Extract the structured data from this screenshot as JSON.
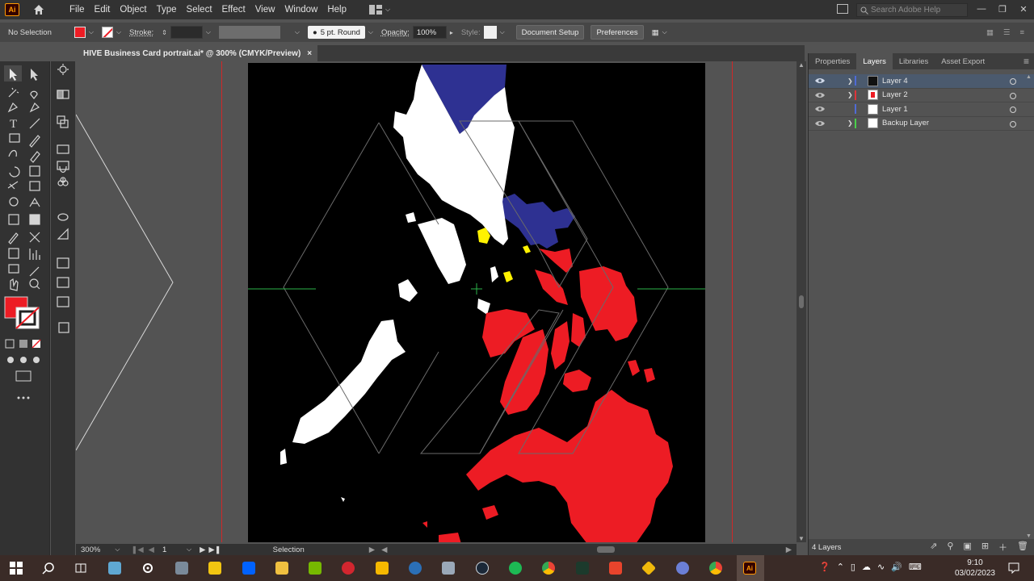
{
  "app": {
    "menu": [
      "File",
      "Edit",
      "Object",
      "Type",
      "Select",
      "Effect",
      "View",
      "Window",
      "Help"
    ],
    "search_placeholder": "Search Adobe Help",
    "logo_text": "Ai"
  },
  "control_bar": {
    "selection": "No Selection",
    "stroke_label": "Stroke:",
    "brush": "5 pt. Round",
    "opacity_label": "Opacity:",
    "opacity_value": "100%",
    "style_label": "Style:",
    "document_setup": "Document Setup",
    "preferences": "Preferences"
  },
  "document": {
    "tab_title": "HIVE Business Card portrait.ai* @ 300% (CMYK/Preview)",
    "close": "×"
  },
  "status": {
    "zoom": "300%",
    "artboard": "1",
    "tool": "Selection"
  },
  "panel": {
    "tabs": [
      "Properties",
      "Layers",
      "Libraries",
      "Asset Export"
    ],
    "active_tab": "Layers",
    "layers": [
      {
        "name": "Layer 4",
        "color": "#4f6bd6",
        "selected": true
      },
      {
        "name": "Layer 2",
        "color": "#e0343a",
        "selected": false
      },
      {
        "name": "Layer 1",
        "color": "#4f6bd6",
        "selected": false
      },
      {
        "name": "Backup Layer",
        "color": "#4ad04a",
        "selected": false
      }
    ],
    "footer": "4 Layers"
  },
  "taskbar": {
    "time": "9:10",
    "date": "03/02/2023"
  },
  "colors": {
    "red": "#ed1c24",
    "blue": "#2e3192",
    "yellow": "#fff200",
    "white": "#ffffff"
  }
}
